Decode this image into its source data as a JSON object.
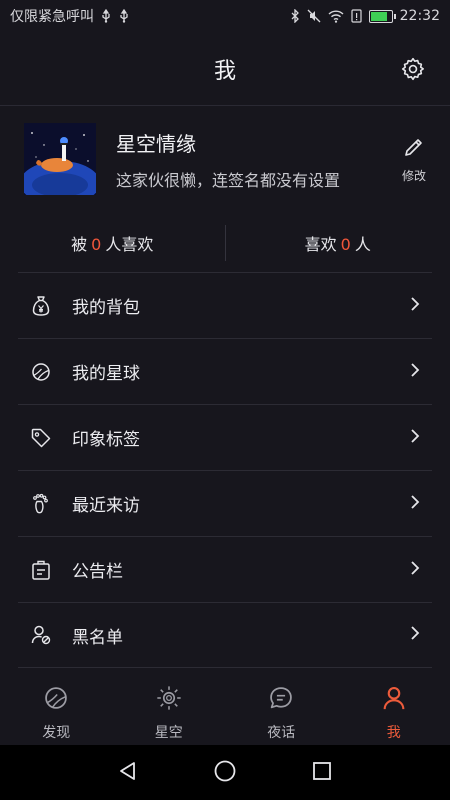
{
  "status_bar": {
    "carrier": "仅限紧急呼叫",
    "time": "22:32"
  },
  "header": {
    "title": "我"
  },
  "profile": {
    "name": "星空情缘",
    "signature": "这家伙很懒，连签名都没有设置",
    "edit_label": "修改"
  },
  "stats": {
    "liked_by": {
      "prefix": "被",
      "count": "0",
      "suffix": "人喜欢"
    },
    "likes": {
      "prefix": "喜欢",
      "count": "0",
      "suffix": "人"
    }
  },
  "menu": [
    {
      "label": "我的背包",
      "icon": "money-bag-icon"
    },
    {
      "label": "我的星球",
      "icon": "planet-icon"
    },
    {
      "label": "印象标签",
      "icon": "tag-icon"
    },
    {
      "label": "最近来访",
      "icon": "footprint-icon"
    },
    {
      "label": "公告栏",
      "icon": "notice-board-icon"
    },
    {
      "label": "黑名单",
      "icon": "blocked-user-icon"
    }
  ],
  "bottom_nav": [
    {
      "label": "发现",
      "icon": "planet-icon",
      "active": false
    },
    {
      "label": "星空",
      "icon": "sun-icon",
      "active": false
    },
    {
      "label": "夜话",
      "icon": "chat-icon",
      "active": false
    },
    {
      "label": "我",
      "icon": "person-icon",
      "active": true
    }
  ],
  "colors": {
    "background": "#17161d",
    "accent": "#ec5b3b",
    "count": "#f0563a",
    "divider": "#2c2b34"
  }
}
